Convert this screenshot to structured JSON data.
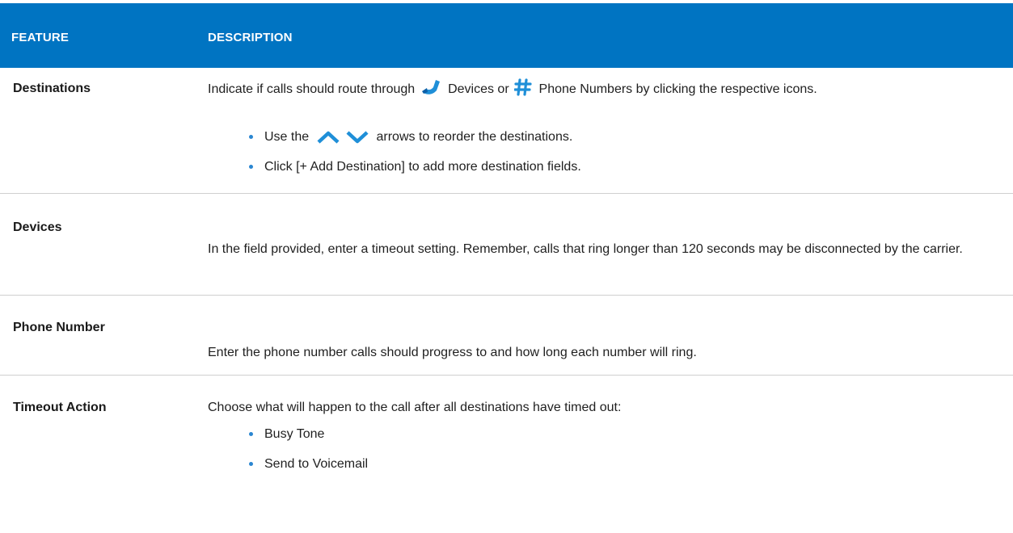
{
  "header": {
    "feature": "FEATURE",
    "description": "DESCRIPTION"
  },
  "rows": [
    {
      "feature": "Destinations",
      "desc_part1": "Indicate if calls should route through",
      "desc_part2": "Devices or",
      "desc_part3": "Phone Numbers by clicking the respective icons.",
      "bullets": [
        {
          "before": "Use the",
          "after": "arrows to reorder the destinations."
        },
        {
          "text": "Click [+ Add Destination] to add more destination fields."
        }
      ],
      "icons": [
        "phone-handset-icon",
        "hash-icon",
        "chevron-up-icon",
        "chevron-down-icon"
      ]
    },
    {
      "feature": "Devices",
      "desc": "In the field provided, enter a timeout setting. Remember, calls that ring longer than 120 seconds may be disconnected by the carrier."
    },
    {
      "feature": "Phone Number",
      "desc": "Enter the phone number calls should progress to and how long each number will ring."
    },
    {
      "feature": "Timeout Action",
      "desc": "Choose what will happen to the call after all destinations have timed out:",
      "bullets": [
        "Busy Tone",
        "Send to Voicemail"
      ]
    }
  ],
  "colors": {
    "header_bg": "#0074c2",
    "bullet": "#2a86d1",
    "icon": "#1f8fd8"
  }
}
